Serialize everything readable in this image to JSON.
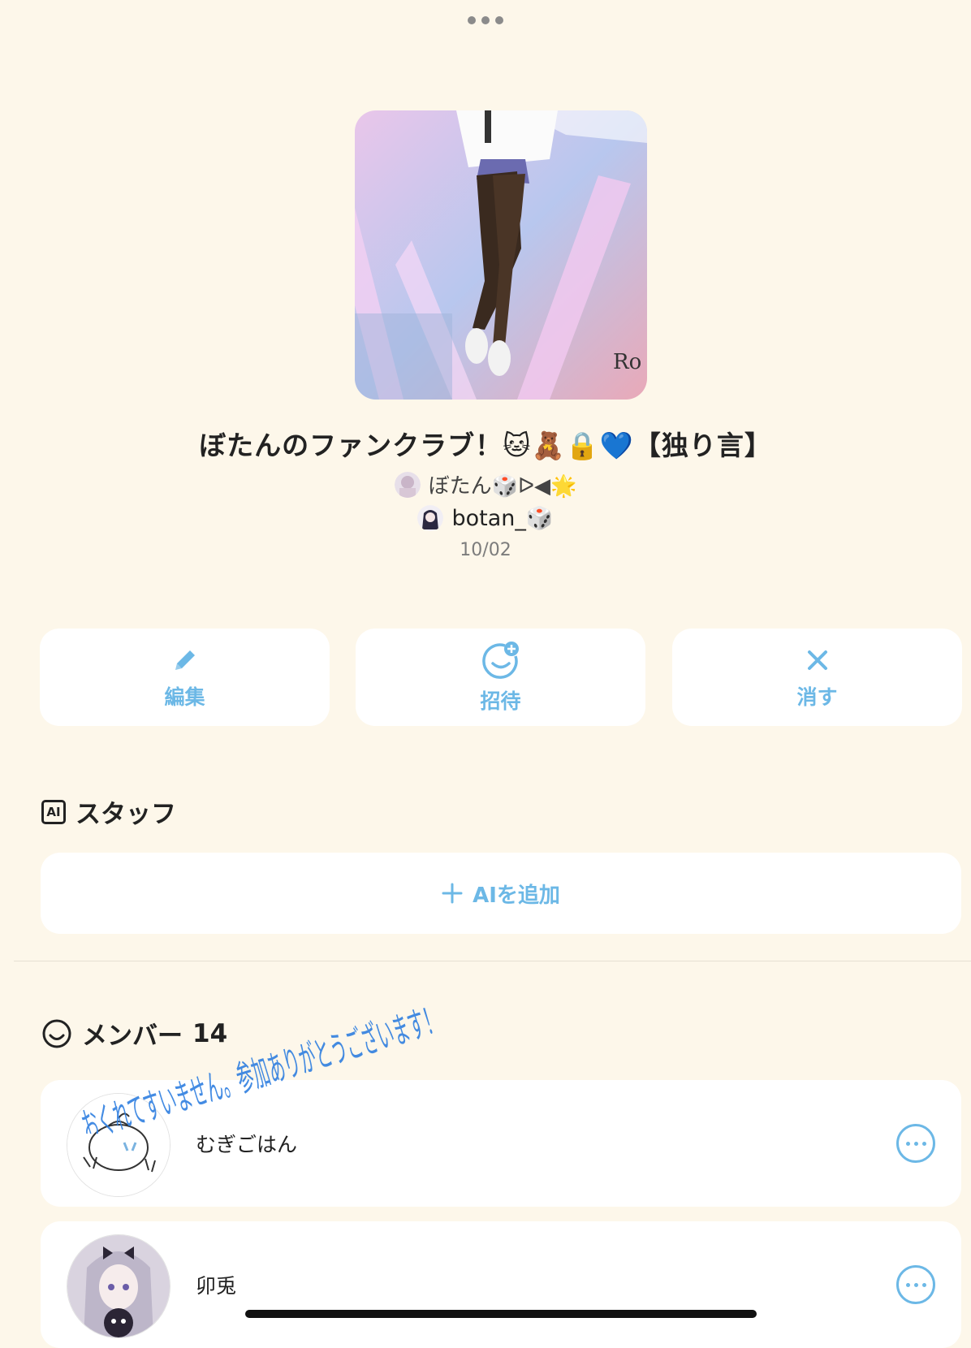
{
  "header": {
    "more_icon": "more-horizontal-icon"
  },
  "group": {
    "title": "ぼたんのファンクラブ！🐱🧸🔒💙【独り言】",
    "owner_name": "ぼたん🎲ᐅ◀︎🌟",
    "creator_name": "botan_🎲",
    "date": "10/02"
  },
  "actions": [
    {
      "label": "編集",
      "icon": "pencil-icon"
    },
    {
      "label": "招待",
      "icon": "invite-smile-icon"
    },
    {
      "label": "消す",
      "icon": "close-icon"
    }
  ],
  "staff": {
    "heading": "スタッフ",
    "badge": "AI",
    "add_label": "AIを追加"
  },
  "members": {
    "heading": "メンバー",
    "count": "14",
    "list": [
      {
        "name": "むぎごはん"
      },
      {
        "name": "卯兎"
      }
    ]
  },
  "handwritten_note": "おくれてすいません。参加ありがとうございます！",
  "colors": {
    "background": "#fdf7ea",
    "accent": "#6cb8e6",
    "card": "#ffffff"
  }
}
